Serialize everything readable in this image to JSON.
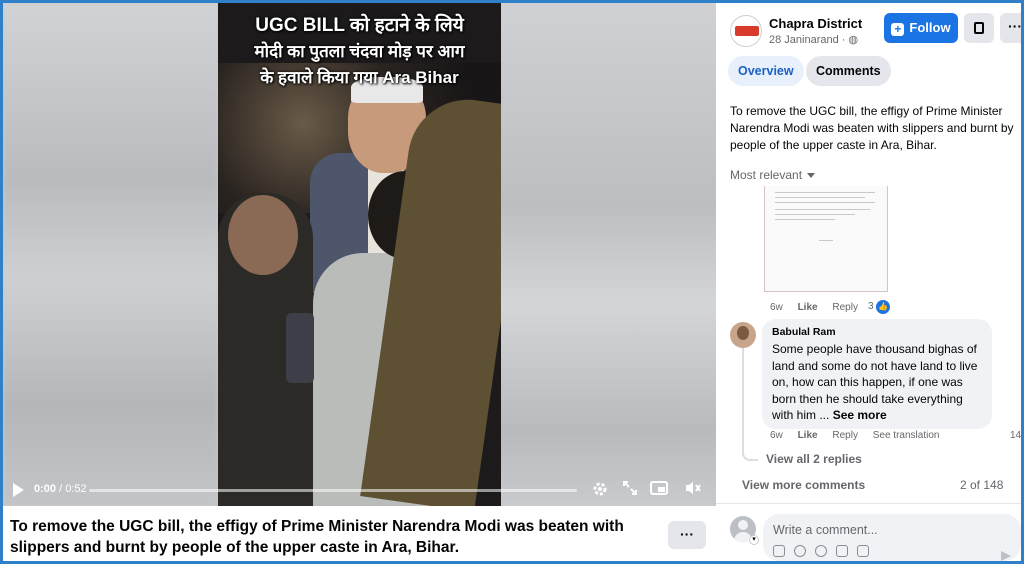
{
  "video": {
    "caption_line1": "UGC BILL को हटाने के लिये",
    "caption_line2": "मोदी का पुतला चंदवा मोड़ पर आग",
    "caption_line3": "के हवाले किया गया  Ara Bihar",
    "time_current": "0:00",
    "time_separator": " / ",
    "time_total": "0:52",
    "progress": 0.0,
    "icons": [
      "play-icon",
      "settings-icon",
      "expand-icon",
      "picture-in-picture-icon",
      "mute-icon"
    ]
  },
  "post": {
    "text": "To remove the UGC bill, the effigy of Prime Minister Narendra Modi was beaten with slippers and burnt by people of the upper caste in Ara, Bihar.",
    "more_label": "···"
  },
  "panel": {
    "page_name": "Chapra District",
    "date": "28 Janinarand",
    "follow_label": "Follow",
    "more_label": "···",
    "tabs": [
      "Overview",
      "Comments"
    ],
    "body": "To remove the UGC bill, the effigy of Prime Minister Narendra Modi was beaten with slippers and burnt by people of the upper caste in Ara, Bihar.",
    "sort_label": "Most relevant"
  },
  "comments": [
    {
      "time": "6w",
      "like": "Like",
      "reply": "Reply",
      "reactions": "3"
    },
    {
      "author": "Babulal Ram",
      "text": "Some people have thousand bighas of land and some do not have land to live on, how can this happen, if one was born then he should take everything with him ...",
      "see_more": "See more",
      "time": "6w",
      "like": "Like",
      "reply": "Reply",
      "translate": "See translation",
      "right_count": "14"
    }
  ],
  "footer": {
    "view_replies": "View all 2 replies",
    "view_more": "View more comments",
    "pager": "2 of 148",
    "comment_placeholder": "Write a comment..."
  },
  "colors": {
    "accent": "#1b74e4",
    "frame": "#2f80c8",
    "tab_active_bg": "#e7f0fb"
  }
}
